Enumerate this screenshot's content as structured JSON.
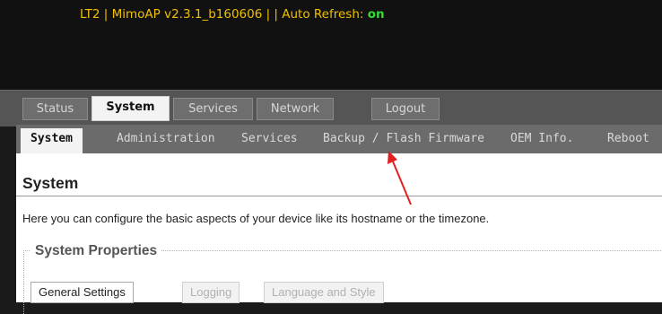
{
  "header": {
    "prefix": "LT2 | MimoAP v2.3.1_b160606 | | Auto Refresh: ",
    "refresh_state": "on"
  },
  "main_tabs": [
    {
      "label": "Status",
      "active": false
    },
    {
      "label": "System",
      "active": true
    },
    {
      "label": "Services",
      "active": false
    },
    {
      "label": "Network",
      "active": false
    },
    {
      "label": "Logout",
      "active": false
    }
  ],
  "sub_tabs": [
    {
      "label": "System",
      "active": true
    },
    {
      "label": "Administration",
      "active": false
    },
    {
      "label": "Services",
      "active": false
    },
    {
      "label": "Backup / Flash Firmware",
      "active": false
    },
    {
      "label": "OEM Info.",
      "active": false
    },
    {
      "label": "Reboot",
      "active": false
    }
  ],
  "page": {
    "title": "System",
    "description": "Here you can configure the basic aspects of your device like its hostname or the timezone."
  },
  "section": {
    "legend": "System Properties",
    "tabs": [
      {
        "label": "General Settings",
        "active": true
      },
      {
        "label": "Logging",
        "active": false
      },
      {
        "label": "Language and Style",
        "active": false
      }
    ]
  },
  "colors": {
    "header_text": "#f0c000",
    "refresh_on": "#33dd33",
    "annotation_arrow": "#e02020"
  }
}
